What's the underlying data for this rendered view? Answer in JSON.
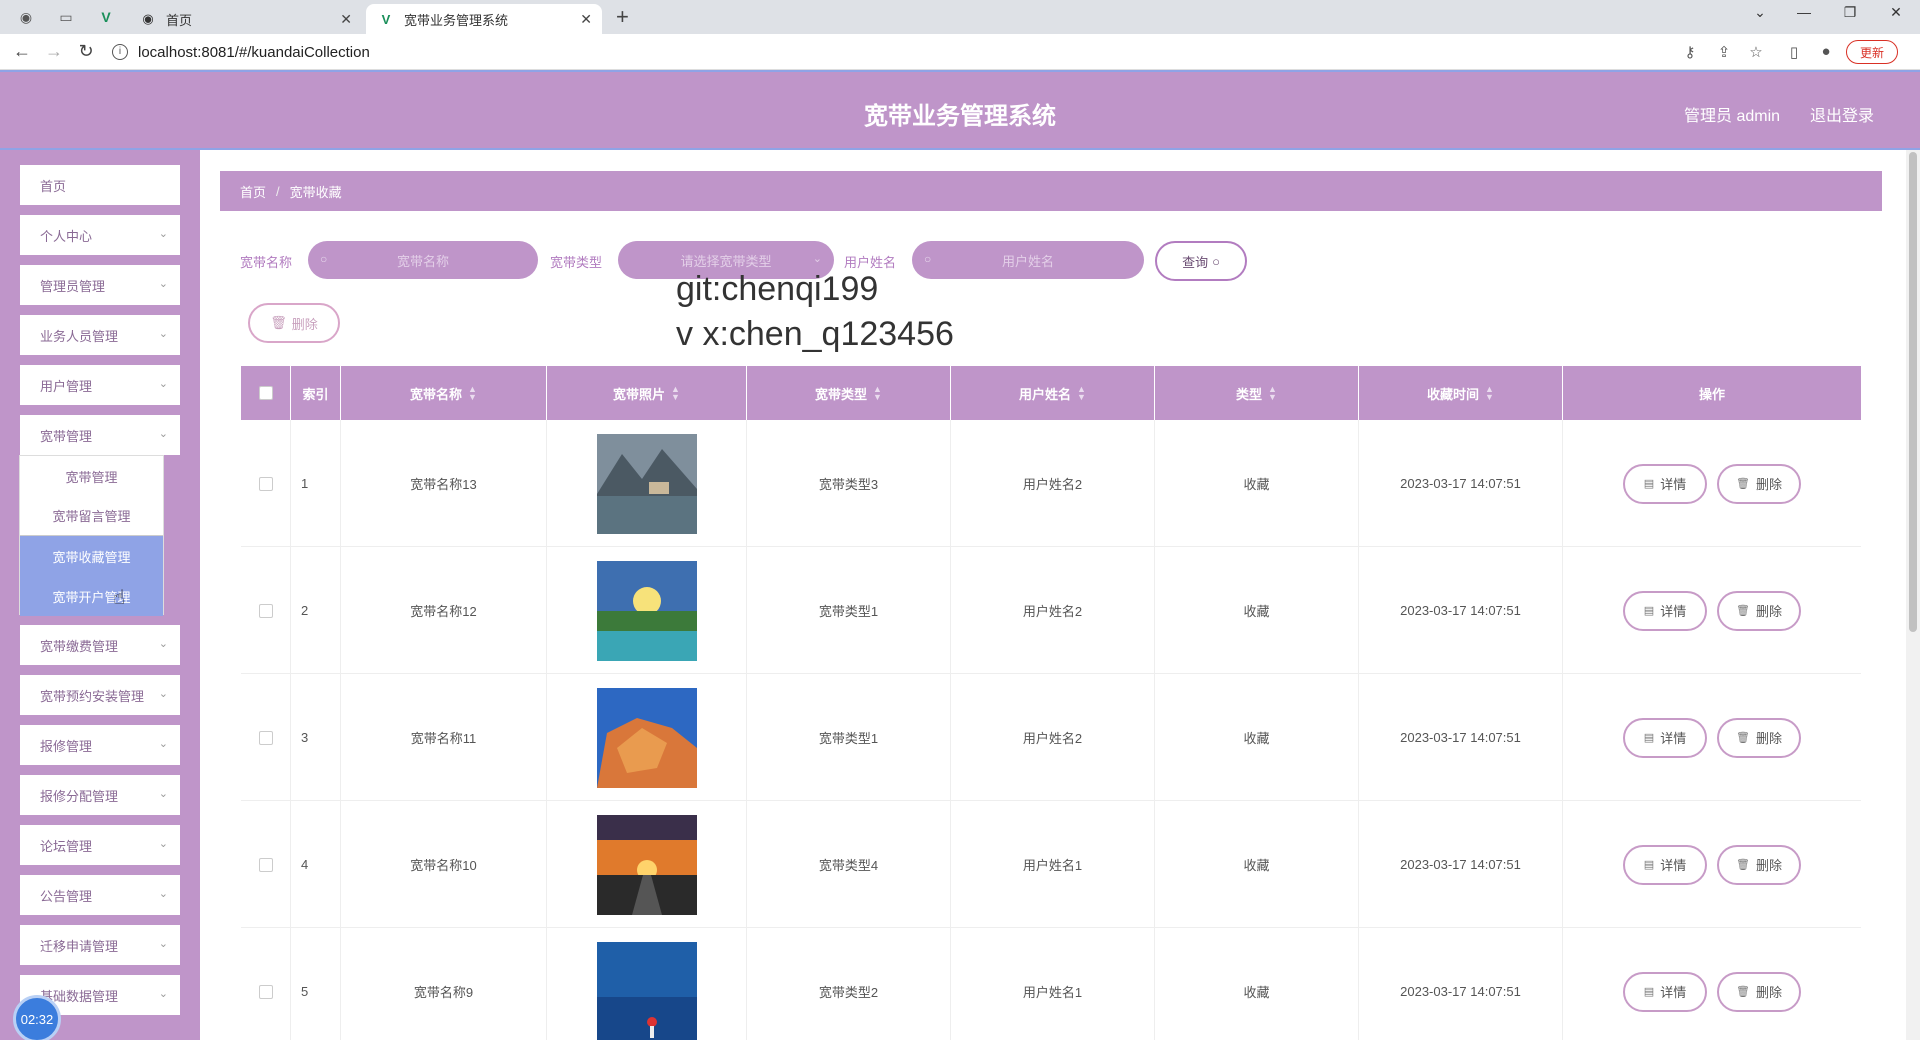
{
  "browser": {
    "tabs": [
      {
        "title": "首页"
      },
      {
        "title": "宽带业务管理系统"
      }
    ],
    "url": "localhost:8081/#/kuandaiCollection",
    "update_label": "更新"
  },
  "header": {
    "title": "宽带业务管理系统",
    "admin_label": "管理员 admin",
    "logout_label": "退出登录"
  },
  "sidebar": {
    "items": [
      {
        "label": "首页"
      },
      {
        "label": "个人中心"
      },
      {
        "label": "管理员管理"
      },
      {
        "label": "业务人员管理"
      },
      {
        "label": "用户管理"
      },
      {
        "label": "宽带管理"
      },
      {
        "label": "宽带缴费管理"
      },
      {
        "label": "宽带预约安装管理"
      },
      {
        "label": "报修管理"
      },
      {
        "label": "报修分配管理"
      },
      {
        "label": "论坛管理"
      },
      {
        "label": "公告管理"
      },
      {
        "label": "迁移申请管理"
      },
      {
        "label": "基础数据管理"
      }
    ],
    "submenu": [
      {
        "label": "宽带管理"
      },
      {
        "label": "宽带留言管理"
      },
      {
        "label": "宽带收藏管理"
      },
      {
        "label": "宽带开户管理"
      }
    ],
    "timer": "02:32"
  },
  "breadcrumb": {
    "home": "首页",
    "current": "宽带收藏"
  },
  "search": {
    "name_label": "宽带名称",
    "name_placeholder": "宽带名称",
    "type_label": "宽带类型",
    "type_placeholder": "请选择宽带类型",
    "user_label": "用户姓名",
    "user_placeholder": "用户姓名",
    "query_label": "查询",
    "delete_label": "删除"
  },
  "watermark": {
    "line1": "git:chenqi199",
    "line2": "v x:chen_q123456"
  },
  "table": {
    "headers": [
      "索引",
      "宽带名称",
      "宽带照片",
      "宽带类型",
      "用户姓名",
      "类型",
      "收藏时间",
      "操作"
    ],
    "detail_label": "详情",
    "delete_label": "删除",
    "rows": [
      {
        "index": "1",
        "name": "宽带名称13",
        "type": "宽带类型3",
        "user": "用户姓名2",
        "kind": "收藏",
        "time": "2023-03-17 14:07:51"
      },
      {
        "index": "2",
        "name": "宽带名称12",
        "type": "宽带类型1",
        "user": "用户姓名2",
        "kind": "收藏",
        "time": "2023-03-17 14:07:51"
      },
      {
        "index": "3",
        "name": "宽带名称11",
        "type": "宽带类型1",
        "user": "用户姓名2",
        "kind": "收藏",
        "time": "2023-03-17 14:07:51"
      },
      {
        "index": "4",
        "name": "宽带名称10",
        "type": "宽带类型4",
        "user": "用户姓名1",
        "kind": "收藏",
        "time": "2023-03-17 14:07:51"
      },
      {
        "index": "5",
        "name": "宽带名称9",
        "type": "宽带类型2",
        "user": "用户姓名1",
        "kind": "收藏",
        "time": "2023-03-17 14:07:51"
      }
    ]
  },
  "colors": {
    "theme": "#bf95c9",
    "accent_blue": "#8fa3e6"
  }
}
